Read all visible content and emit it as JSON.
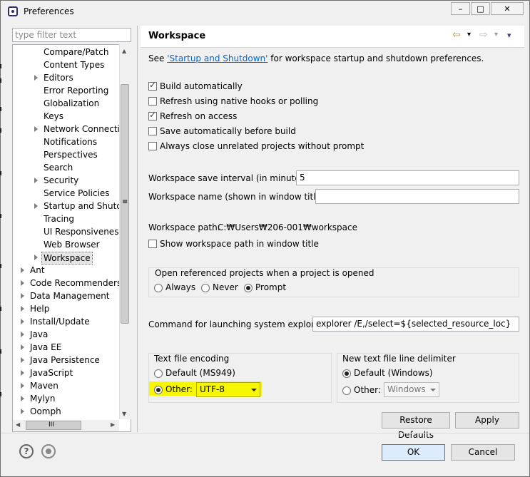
{
  "window": {
    "title": "Preferences",
    "minimize": "–",
    "maximize": "□",
    "close": "✕"
  },
  "filter": {
    "placeholder": "type filter text"
  },
  "tree": {
    "children": [
      "Compare/Patch",
      "Content Types",
      "Editors",
      "Error Reporting",
      "Globalization",
      "Keys",
      "Network Connection",
      "Notifications",
      "Perspectives",
      "Search",
      "Security",
      "Service Policies",
      "Startup and Shutdo",
      "Tracing",
      "UI Responsiveness M",
      "Web Browser",
      "Workspace"
    ],
    "top": [
      "Ant",
      "Code Recommenders",
      "Data Management",
      "Help",
      "Install/Update",
      "Java",
      "Java EE",
      "Java Persistence",
      "JavaScript",
      "Maven",
      "Mylyn",
      "Oomph"
    ],
    "scroll_hint": "≡",
    "hgrip": "III"
  },
  "page": {
    "title": "Workspace",
    "nav": {
      "back": "⇦",
      "back_menu": "▾",
      "forward": "⇨",
      "forward_menu": "▾",
      "view_menu": "▾"
    },
    "see_prefix": "See ",
    "see_link": "'Startup and Shutdown'",
    "see_suffix": " for workspace startup and shutdown preferences.",
    "checkboxes": [
      {
        "label": "Build automatically",
        "checked": true
      },
      {
        "label": "Refresh using native hooks or polling",
        "checked": false
      },
      {
        "label": "Refresh on access",
        "checked": true
      },
      {
        "label": "Save automatically before build",
        "checked": false
      },
      {
        "label": "Always close unrelated projects without prompt",
        "checked": false
      }
    ],
    "save_interval_label": "Workspace save interval (in minutes):",
    "save_interval_value": "5",
    "workspace_name_label": "Workspace name (shown in window title):",
    "workspace_name_value": "",
    "workspace_path_label": "Workspace path:",
    "workspace_path_value": "C:₩Users₩206-001₩workspace",
    "show_path_label": "Show workspace path in window title",
    "open_ref": {
      "label": "Open referenced projects when a project is opened",
      "options": [
        "Always",
        "Never",
        "Prompt"
      ],
      "selected": "Prompt"
    },
    "explorer_label": "Command for launching system explorer:",
    "explorer_value": "explorer /E,/select=${selected_resource_loc}",
    "encoding": {
      "label": "Text file encoding",
      "default_label": "Default (MS949)",
      "other_label": "Other:",
      "other_value": "UTF-8",
      "selected": "Other"
    },
    "delimiter": {
      "label": "New text file line delimiter",
      "default_label": "Default (Windows)",
      "other_label": "Other:",
      "other_value": "Windows",
      "selected": "Default"
    },
    "restore_defaults": "Restore Defaults",
    "apply": "Apply"
  },
  "footer": {
    "help_icon": "?",
    "ok": "OK",
    "cancel": "Cancel"
  },
  "colors": {
    "highlight": "#f7f700",
    "link": "#0066cc"
  }
}
